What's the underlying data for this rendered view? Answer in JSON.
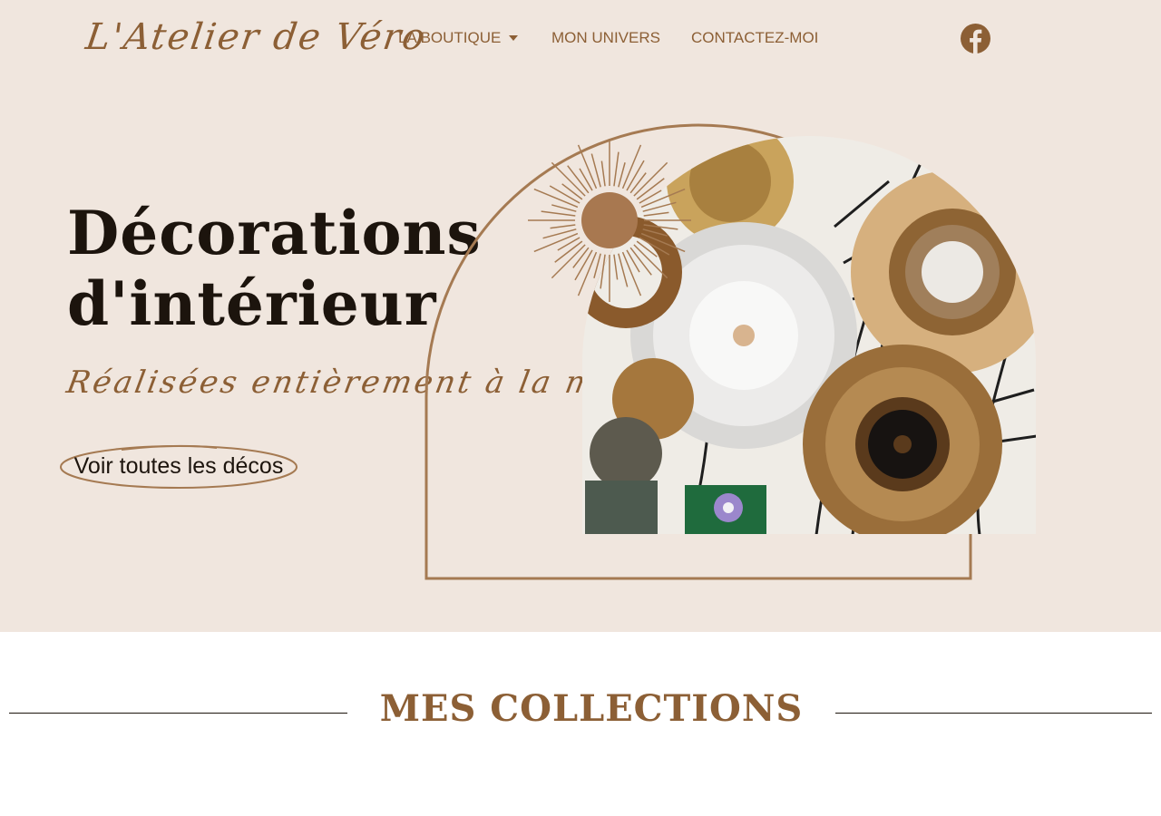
{
  "colors": {
    "hero_bg": "#f0e6de",
    "brand_brown": "#8c5f35",
    "arch_brown": "#a57a52",
    "dark_text": "#1c140d"
  },
  "header": {
    "logo_text": "L'Atelier de Véro",
    "nav": [
      {
        "label": "LA BOUTIQUE",
        "has_dropdown": true
      },
      {
        "label": "MON UNIVERS",
        "has_dropdown": false
      },
      {
        "label": "CONTACTEZ-MOI",
        "has_dropdown": false
      }
    ],
    "social_icon": "facebook-icon"
  },
  "hero": {
    "title_line1": "Décorations",
    "title_line2": "d'intérieur",
    "subtitle": "Réalisées entièrement à la main",
    "cta_label": "Voir toutes les décos",
    "image_icon": "juju-hat-wall-decor-photo"
  },
  "collections": {
    "title": "MES COLLECTIONS"
  }
}
